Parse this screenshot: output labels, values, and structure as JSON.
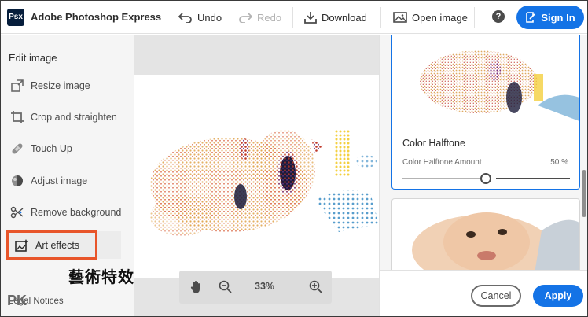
{
  "app": {
    "logo": "Psx",
    "title": "Adobe Photoshop Express"
  },
  "toolbar": {
    "undo_label": "Undo",
    "redo_label": "Redo",
    "download_label": "Download",
    "open_image_label": "Open image",
    "help_symbol": "?",
    "signin_label": "Sign In",
    "accent_color": "#1473e6"
  },
  "sidebar": {
    "heading": "Edit image",
    "items": [
      {
        "label": "Resize image",
        "icon": "resize-icon"
      },
      {
        "label": "Crop and straighten",
        "icon": "crop-icon"
      },
      {
        "label": "Touch Up",
        "icon": "bandage-icon"
      },
      {
        "label": "Adjust image",
        "icon": "adjust-icon"
      },
      {
        "label": "Remove background",
        "icon": "remove-background-icon"
      },
      {
        "label": "Art effects",
        "icon": "art-effects-icon"
      }
    ],
    "active_index": 5,
    "annotation": "藝術特效",
    "annotation_color": "#e8552a",
    "legal_label": "Legal Notices",
    "watermark": "PK"
  },
  "canvas": {
    "zoom_value": "33%"
  },
  "effects_panel": {
    "selected_effect": {
      "title": "Color Halftone",
      "slider_label": "Color Halftone Amount",
      "slider_value_text": "50 %",
      "slider_value": 0.5
    }
  },
  "footer": {
    "cancel_label": "Cancel",
    "apply_label": "Apply"
  }
}
